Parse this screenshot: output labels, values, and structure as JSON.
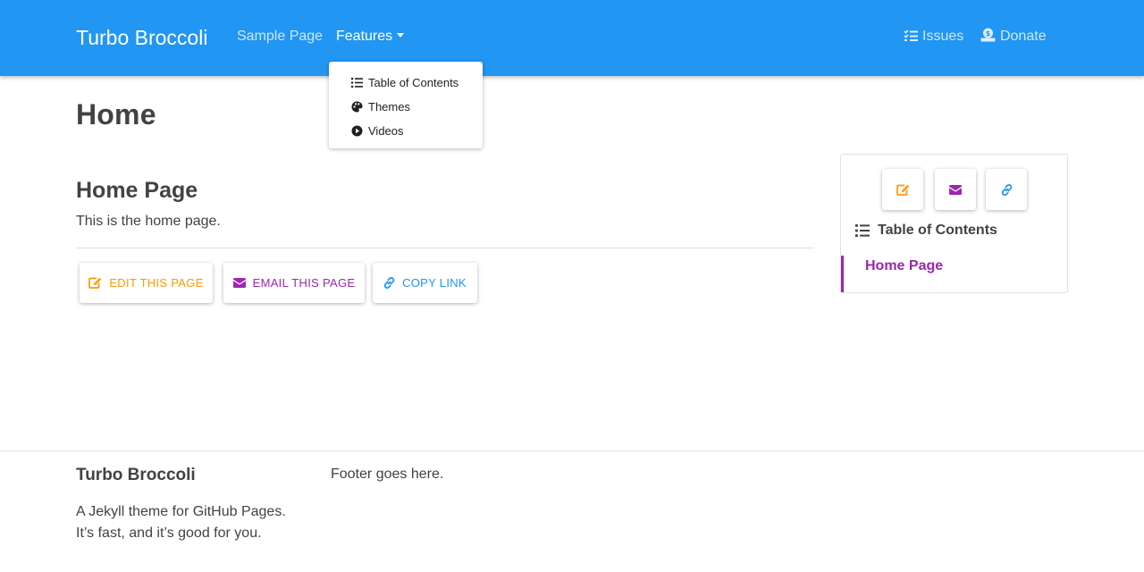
{
  "navbar": {
    "brand": "Turbo Broccoli",
    "links": {
      "sample_page": "Sample Page",
      "features": "Features",
      "issues": "Issues",
      "donate": "Donate"
    }
  },
  "features_menu": {
    "items": [
      "Table of Contents",
      "Themes",
      "Videos"
    ]
  },
  "main": {
    "page_title": "Home",
    "section_title": "Home Page",
    "body": "This is the home page.",
    "actions": {
      "edit": "EDIT THIS PAGE",
      "email": "EMAIL THIS PAGE",
      "copy": "COPY LINK"
    }
  },
  "sidebar": {
    "toc_heading": "Table of Contents",
    "toc_items": [
      "Home Page"
    ]
  },
  "footer": {
    "title": "Turbo Broccoli",
    "description_line1": "A Jekyll theme for GitHub Pages.",
    "description_line2": "It’s fast, and it’s good for you.",
    "note": "Footer goes here."
  },
  "colors": {
    "primary": "#2196f3",
    "edit": "#ff9800",
    "email": "#9c27b0",
    "link": "#2196f3",
    "text": "#424242"
  },
  "icons": {
    "issues": "tasks-icon",
    "donate": "donate-icon",
    "toc": "list-icon",
    "themes": "palette-icon",
    "videos": "play-circle-icon",
    "edit": "edit-icon",
    "email": "envelope-icon",
    "copy": "link-icon"
  }
}
